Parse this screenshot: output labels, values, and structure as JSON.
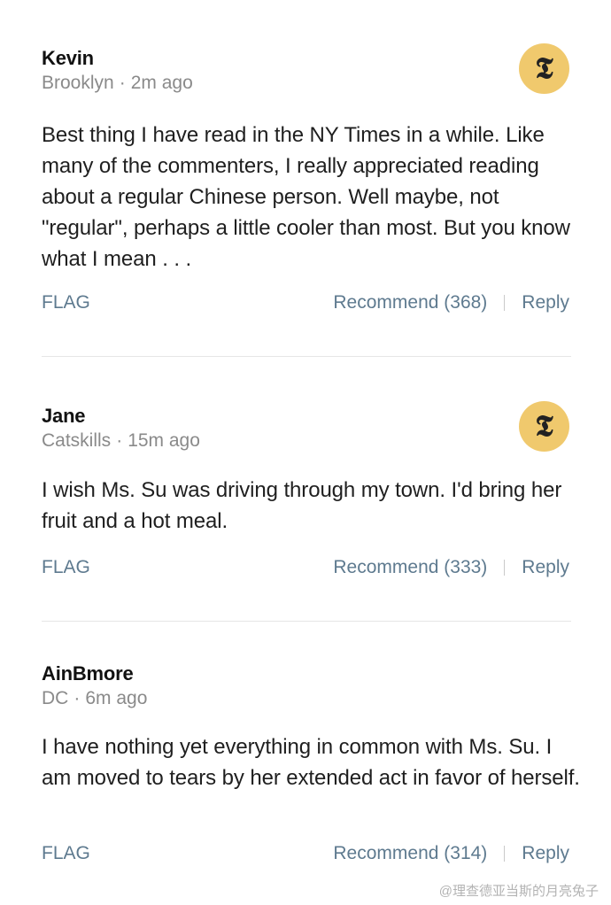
{
  "comments": [
    {
      "name": "Kevin",
      "location": "Brooklyn",
      "separator": "·",
      "time": "2m ago",
      "body": "Best thing I have read in the NY Times in a while. Like many of the commenters, I really appreciated reading about a regular Chinese person. Well maybe, not \"regular\", perhaps a little cooler than most. But you know what I mean . . .",
      "flag_label": "FLAG",
      "recommend_label": "Recommend (368)",
      "reply_label": "Reply",
      "badge_glyph": "𝕿"
    },
    {
      "name": "Jane",
      "location": "Catskills",
      "separator": "·",
      "time": "15m ago",
      "body": "I wish Ms. Su was driving through my town. I'd bring her fruit and a hot meal.",
      "flag_label": "FLAG",
      "recommend_label": "Recommend (333)",
      "reply_label": "Reply",
      "badge_glyph": "𝕿"
    },
    {
      "name": "AinBmore",
      "location": "DC",
      "separator": "·",
      "time": "6m ago",
      "body": "I have nothing yet everything in common with Ms. Su. I am moved to tears by her extended act in favor of herself.",
      "flag_label": "FLAG",
      "recommend_label": "Recommend (314)",
      "reply_label": "Reply"
    }
  ],
  "watermark": "@理查德亚当斯的月亮兔子",
  "colors": {
    "badge": "#f0c96d",
    "action_text": "#5e7a8f",
    "meta_text": "#8a8a8a"
  },
  "icons": {
    "badge": "nyt-logo-icon"
  }
}
